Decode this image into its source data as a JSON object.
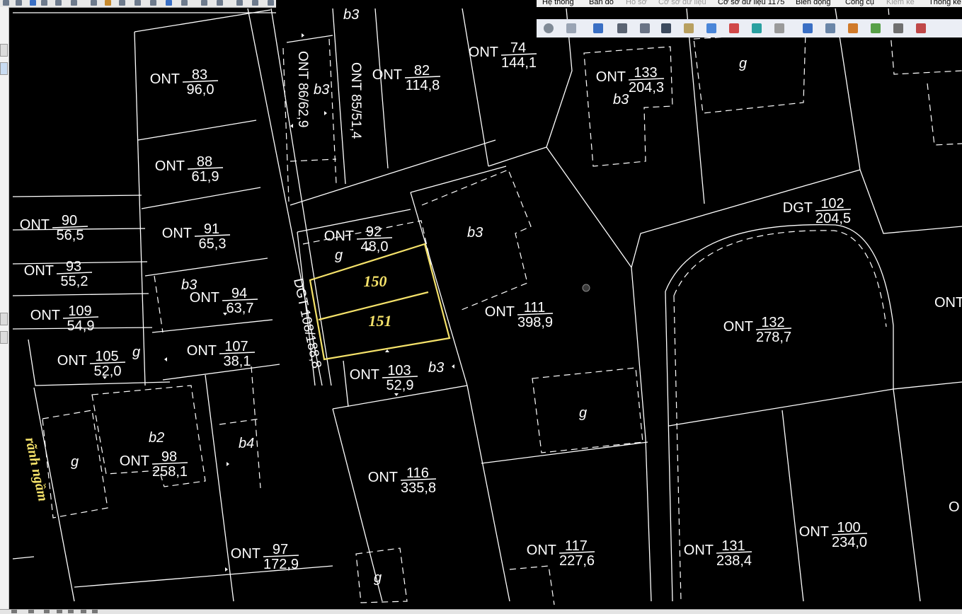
{
  "menu": {
    "items": [
      {
        "label": "Hệ thống",
        "enabled": true
      },
      {
        "label": "Bản đồ",
        "enabled": true
      },
      {
        "label": "Hồ sơ",
        "enabled": false
      },
      {
        "label": "Cơ sở dữ liệu",
        "enabled": false
      },
      {
        "label": "Cơ sở dữ liệu 1175",
        "enabled": true
      },
      {
        "label": "Biến động",
        "enabled": true
      },
      {
        "label": "Công cụ",
        "enabled": true
      },
      {
        "label": "Kiểm kê",
        "enabled": false
      },
      {
        "label": "Thống kê",
        "enabled": true
      }
    ]
  },
  "toolbar": {
    "icons": [
      "info-icon",
      "table-icon",
      "users-icon",
      "parcel-icon",
      "search-map-icon",
      "zoom-extent-icon",
      "grid-icon",
      "link-icon",
      "clear-selection-icon",
      "marker-icon",
      "document-icon",
      "edit-icon",
      "export-icon",
      "map-icon",
      "layers-icon",
      "tools-icon",
      "globe-icon"
    ]
  },
  "colors": {
    "background": "#000000",
    "lines": "#ffffff",
    "highlight": "#f5e26a"
  },
  "map": {
    "parcels": [
      {
        "type": "ONT",
        "id": "83",
        "area": "96,0"
      },
      {
        "type": "ONT",
        "id": "82",
        "area": "114,8"
      },
      {
        "type": "ONT",
        "id": "74",
        "area": "144,1"
      },
      {
        "type": "ONT",
        "id": "133",
        "area": "204,3"
      },
      {
        "type": "ONT",
        "id": "88",
        "area": "61,9"
      },
      {
        "type": "ONT",
        "id": "90",
        "area": "56,5"
      },
      {
        "type": "ONT",
        "id": "91",
        "area": "65,3"
      },
      {
        "type": "ONT",
        "id": "92",
        "area": "48,0"
      },
      {
        "type": "ONT",
        "id": "93",
        "area": "55,2"
      },
      {
        "type": "ONT",
        "id": "94",
        "area": "63,7"
      },
      {
        "type": "ONT",
        "id": "109",
        "area": "54,9"
      },
      {
        "type": "ONT",
        "id": "107",
        "area": "38,1"
      },
      {
        "type": "ONT",
        "id": "105",
        "area": "52,0"
      },
      {
        "type": "ONT",
        "id": "103",
        "area": "52,9"
      },
      {
        "type": "ONT",
        "id": "111",
        "area": "398,9"
      },
      {
        "type": "ONT",
        "id": "132",
        "area": "278,7"
      },
      {
        "type": "DGT",
        "id": "102",
        "area": "204,5"
      },
      {
        "type": "ONT",
        "id": "98",
        "area": "258,1"
      },
      {
        "type": "ONT",
        "id": "116",
        "area": "335,8"
      },
      {
        "type": "ONT",
        "id": "97",
        "area": "172,9"
      },
      {
        "type": "ONT",
        "id": "117",
        "area": "227,6"
      },
      {
        "type": "ONT",
        "id": "131",
        "area": "238,4"
      },
      {
        "type": "ONT",
        "id": "100",
        "area": "234,0"
      }
    ],
    "vertical_labels": [
      "ONT 86/62,9",
      "ONT 85/51,4",
      "DGT 108/188,8"
    ],
    "highlighted": [
      "150",
      "151"
    ],
    "water_label": "rãnh ngầm",
    "partial_labels": [
      "ONT",
      "O"
    ],
    "building_labels": [
      "b3",
      "b2",
      "b4",
      "g"
    ]
  }
}
